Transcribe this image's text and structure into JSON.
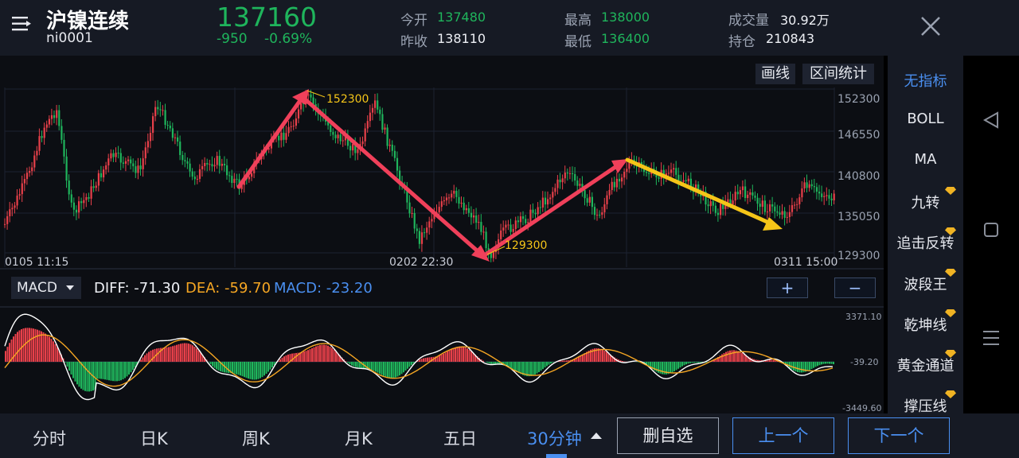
{
  "header": {
    "title": "沪镍连续",
    "code": "ni0001",
    "price": "137160",
    "change": "-950",
    "change_pct": "-0.69%",
    "open_label": "今开",
    "open": "137480",
    "prev_close_label": "昨收",
    "prev_close": "138110",
    "high_label": "最高",
    "high": "138000",
    "low_label": "最低",
    "low": "136400",
    "volume_label": "成交量",
    "volume": "30.92万",
    "oi_label": "持仓",
    "oi": "210843"
  },
  "toolbar": {
    "draw_line": "画线",
    "range_stats": "区间统计"
  },
  "price_axis": [
    "152300",
    "146550",
    "140800",
    "135050",
    "129300"
  ],
  "annotations": {
    "high_mark": "152300",
    "low_mark": "129300"
  },
  "time_labels": {
    "left": "0105  11:15",
    "mid": "0202  22:30",
    "right": "0311  15:00"
  },
  "macd": {
    "selector": "MACD",
    "diff_label": "DIFF: -71.30",
    "dea_label": "DEA: -59.70",
    "macd_label": "MACD: -23.20",
    "axis": [
      "3371.10",
      "-39.20",
      "-3449.60"
    ],
    "plus": "+",
    "minus": "−"
  },
  "indicators": [
    "无指标",
    "BOLL",
    "MA",
    "九转",
    "追击反转",
    "波段王",
    "乾坤线",
    "黄金通道",
    "撑压线"
  ],
  "bottom": {
    "tabs": [
      "分时",
      "日K",
      "周K",
      "月K",
      "五日",
      "30分钟"
    ],
    "delete_watch": "删自选",
    "prev": "上一个",
    "next": "下一个"
  },
  "colors": {
    "up": "#e8404a",
    "down": "#1fb55c",
    "accent": "#4a8ff0",
    "arrow_red": "#f0405a",
    "arrow_yellow": "#f5c518"
  }
}
